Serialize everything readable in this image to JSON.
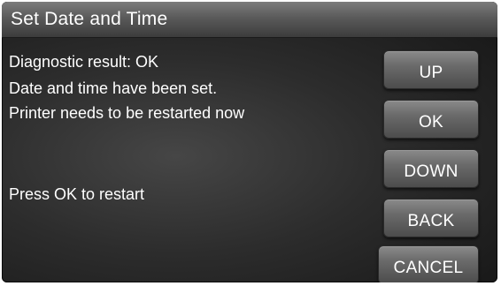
{
  "title": "Set Date and Time",
  "messages": {
    "line1": "Diagnostic result: OK",
    "line2": "Date and time have been set.",
    "line3": "Printer needs to be restarted now",
    "prompt": "Press OK to restart"
  },
  "buttons": {
    "up": "UP",
    "ok": "OK",
    "down": "DOWN",
    "back": "BACK",
    "cancel": "CANCEL"
  }
}
